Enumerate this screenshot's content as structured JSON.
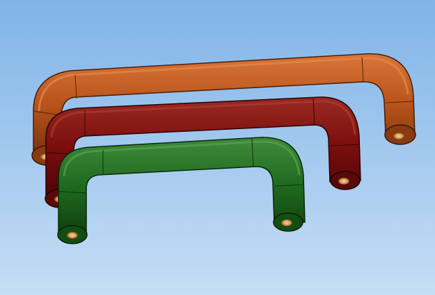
{
  "viewport": {
    "background_top": "#7fb4e8",
    "background_bottom": "#c6ddf5"
  },
  "handles": [
    {
      "name": "orange-handle",
      "color": "#b8541a",
      "edge": "#5a2306",
      "highlight": "#d9763a"
    },
    {
      "name": "maroon-handle",
      "color": "#7a0d0d",
      "edge": "#3a0303",
      "highlight": "#9a2a22"
    },
    {
      "name": "green-handle",
      "color": "#1f6a1f",
      "edge": "#0b330b",
      "highlight": "#3f8a3a"
    }
  ],
  "insert_color": "#e0b070"
}
